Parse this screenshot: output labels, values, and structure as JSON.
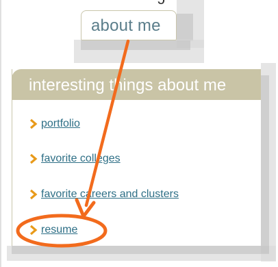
{
  "tab": {
    "label": "about me"
  },
  "panel": {
    "title": "interesting things about me",
    "items": [
      {
        "label": "portfolio"
      },
      {
        "label": "favorite colleges"
      },
      {
        "label": "favorite careers and clusters"
      },
      {
        "label": "resume"
      }
    ]
  },
  "colors": {
    "header_bg": "#c9c4a6",
    "link": "#2e6f86",
    "tab_text": "#5a7d8a",
    "bullet": "#e89a1a",
    "annotation": "#f26b1d"
  },
  "icons": {
    "bullet": "chevron-right-icon",
    "annotation_arrow": "arrow-icon",
    "annotation_circle": "highlight-circle"
  }
}
